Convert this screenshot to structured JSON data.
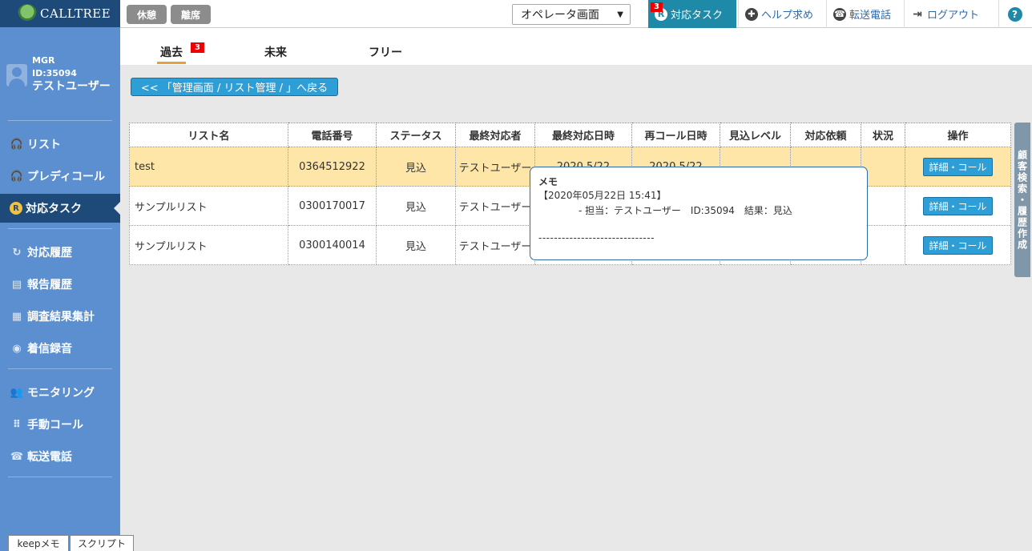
{
  "sidebar": {
    "logo_text": "CALLTREE",
    "user": {
      "role": "MGR",
      "id": "ID:35094",
      "name": "テストユーザー"
    },
    "items": [
      {
        "label": "リスト",
        "icon": "headset-icon"
      },
      {
        "label": "プレディコール",
        "icon": "headset-icon"
      },
      {
        "label": "対応タスク",
        "icon": "task-badge-icon",
        "badge": "R"
      },
      {
        "label": "対応履歴",
        "icon": "history-icon"
      },
      {
        "label": "報告履歴",
        "icon": "report-icon"
      },
      {
        "label": "調査結果集計",
        "icon": "clipboard-icon"
      },
      {
        "label": "着信録音",
        "icon": "record-icon"
      },
      {
        "label": "モニタリング",
        "icon": "users-icon"
      },
      {
        "label": "手動コール",
        "icon": "keypad-icon"
      },
      {
        "label": "転送電話",
        "icon": "phone-icon"
      }
    ]
  },
  "bottom_tabs": [
    "keepメモ",
    "スクリプト"
  ],
  "topbar": {
    "break_label": "休憩",
    "away_label": "離席",
    "mode_select": "オペレータ画面",
    "task_label": "対応タスク",
    "task_badge": "3",
    "help_label": "ヘルプ求め",
    "transfer_label": "転送電話",
    "logout_label": "ログアウト",
    "help_icon_glyph": "?"
  },
  "tabs": [
    {
      "label": "過去",
      "active": true
    },
    {
      "label": "未来",
      "active": false
    },
    {
      "label": "フリー",
      "active": false
    }
  ],
  "tab_badge": "3",
  "back_button": "<< 「管理画面 / リスト管理 / 」へ戻る",
  "table": {
    "headers": [
      "リスト名",
      "電話番号",
      "ステータス",
      "最終対応者",
      "最終対応日時",
      "再コール日時",
      "見込レベル",
      "対応依頼",
      "状況",
      "操作"
    ],
    "rows": [
      {
        "list": "test",
        "phone": "0364512922",
        "status": "見込",
        "agent": "テストユーザー",
        "last_date": "2020 5/22",
        "recall": "2020 5/22",
        "action": "詳細・コール"
      },
      {
        "list": "サンプルリスト",
        "phone": "0300170017",
        "status": "見込",
        "agent": "テストユーザー",
        "last_date": "",
        "recall": "",
        "action": "詳細・コール"
      },
      {
        "list": "サンプルリスト",
        "phone": "0300140014",
        "status": "見込",
        "agent": "テストユーザー",
        "last_date": "",
        "recall": "",
        "action": "詳細・コール"
      }
    ]
  },
  "memo": {
    "title": "メモ",
    "date_line": "【2020年05月22日 15:41】",
    "detail_line": "- 担当：テストユーザー　ID:35094　結果：見込",
    "separator": "------------------------------"
  },
  "side_tab": "顧客検索・履歴作成",
  "colors": {
    "sidebar": "#5b8fcf",
    "sidebar_dark": "#1e4a7a",
    "accent": "#2e9ed6",
    "highlight_row": "#fde6a8",
    "task_button": "#1e8aa8"
  }
}
